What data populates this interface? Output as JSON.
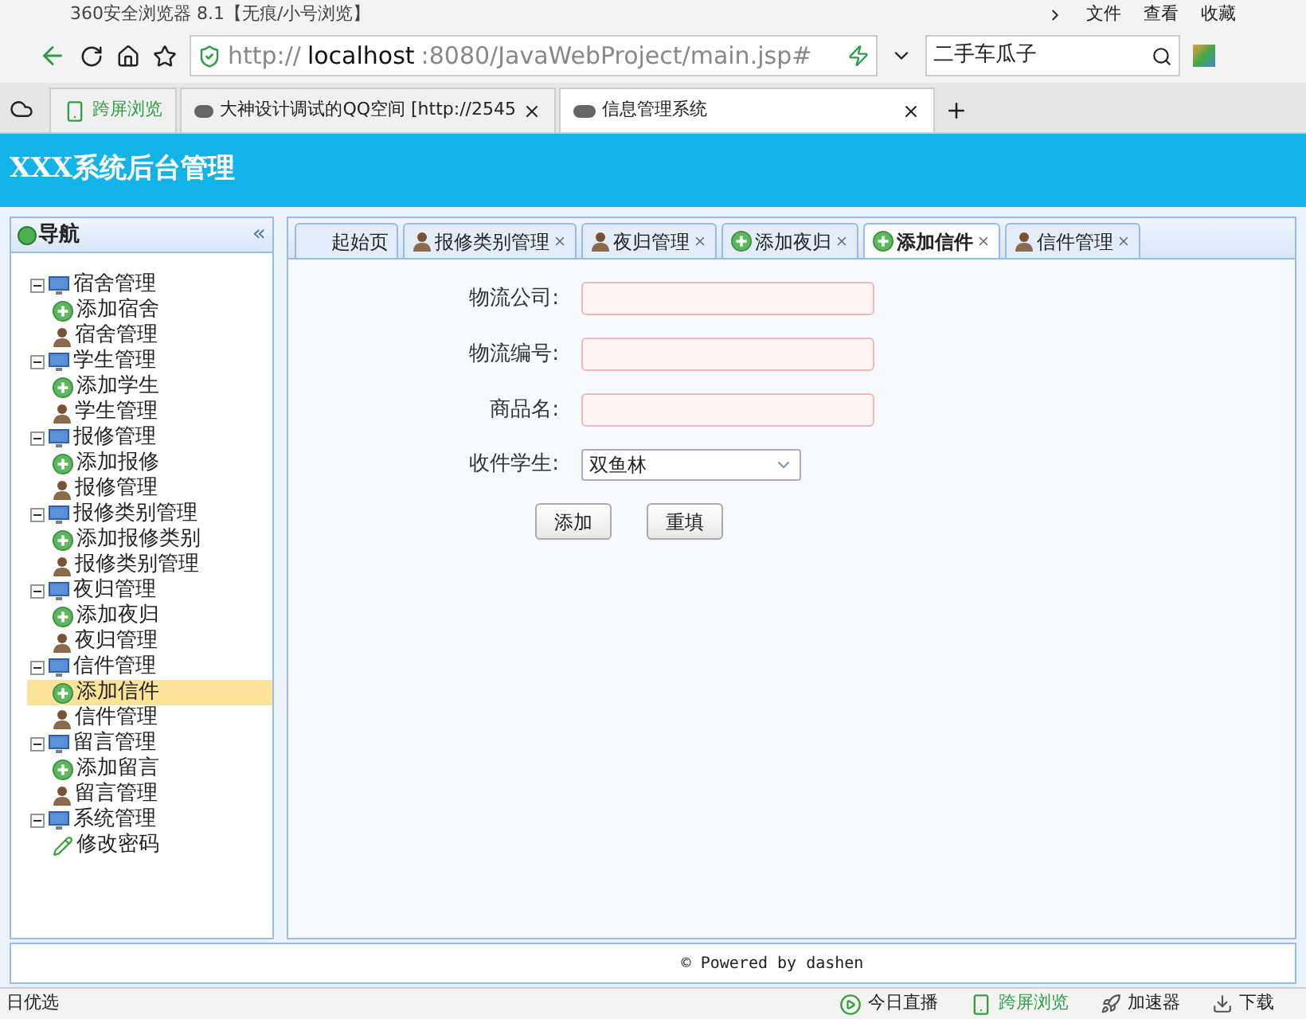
{
  "browser": {
    "title": "360安全浏览器 8.1【无痕/小号浏览】",
    "menu": [
      "文件",
      "查看",
      "收藏"
    ],
    "address": {
      "scheme": "http://",
      "host": "localhost",
      "rest": ":8080/JavaWebProject/main.jsp#"
    },
    "search": {
      "value": "二手车瓜子"
    },
    "tabs": [
      {
        "kind": "pinned",
        "label": "跨屏浏览",
        "selected": false
      },
      {
        "kind": "page",
        "label": "大神设计调试的QQ空间 [http://2545",
        "selected": false
      },
      {
        "kind": "page",
        "label": "信息管理系统",
        "selected": true
      }
    ]
  },
  "header": {
    "title": "XXX系统后台管理"
  },
  "nav": {
    "title": "导航",
    "collapse": "«",
    "groups": [
      {
        "label": "宿舍管理",
        "expanded": true,
        "children": [
          {
            "kind": "add",
            "label": "添加宿舍",
            "selected": false
          },
          {
            "kind": "manage",
            "label": "宿舍管理",
            "selected": false
          }
        ]
      },
      {
        "label": "学生管理",
        "expanded": true,
        "children": [
          {
            "kind": "add",
            "label": "添加学生",
            "selected": false
          },
          {
            "kind": "manage",
            "label": "学生管理",
            "selected": false
          }
        ]
      },
      {
        "label": "报修管理",
        "expanded": true,
        "children": [
          {
            "kind": "add",
            "label": "添加报修",
            "selected": false
          },
          {
            "kind": "manage",
            "label": "报修管理",
            "selected": false
          }
        ]
      },
      {
        "label": "报修类别管理",
        "expanded": true,
        "children": [
          {
            "kind": "add",
            "label": "添加报修类别",
            "selected": false
          },
          {
            "kind": "manage",
            "label": "报修类别管理",
            "selected": false
          }
        ]
      },
      {
        "label": "夜归管理",
        "expanded": true,
        "children": [
          {
            "kind": "add",
            "label": "添加夜归",
            "selected": false
          },
          {
            "kind": "manage",
            "label": "夜归管理",
            "selected": false
          }
        ]
      },
      {
        "label": "信件管理",
        "expanded": true,
        "children": [
          {
            "kind": "add",
            "label": "添加信件",
            "selected": true
          },
          {
            "kind": "manage",
            "label": "信件管理",
            "selected": false
          }
        ]
      },
      {
        "label": "留言管理",
        "expanded": true,
        "children": [
          {
            "kind": "add",
            "label": "添加留言",
            "selected": false
          },
          {
            "kind": "manage",
            "label": "留言管理",
            "selected": false
          }
        ]
      },
      {
        "label": "系统管理",
        "expanded": true,
        "children": [
          {
            "kind": "edit",
            "label": "修改密码",
            "selected": false
          }
        ]
      }
    ]
  },
  "content_tabs": [
    {
      "kind": "home",
      "label": "起始页",
      "closable": false,
      "selected": false
    },
    {
      "kind": "manage",
      "label": "报修类别管理",
      "closable": true,
      "selected": false
    },
    {
      "kind": "manage",
      "label": "夜归管理",
      "closable": true,
      "selected": false
    },
    {
      "kind": "add",
      "label": "添加夜归",
      "closable": true,
      "selected": false
    },
    {
      "kind": "add",
      "label": "添加信件",
      "closable": true,
      "selected": true
    },
    {
      "kind": "manage",
      "label": "信件管理",
      "closable": true,
      "selected": false
    }
  ],
  "form": {
    "fields": [
      {
        "kind": "text",
        "label": "物流公司:"
      },
      {
        "kind": "text",
        "label": "物流编号:"
      },
      {
        "kind": "text",
        "label": "商品名:"
      },
      {
        "kind": "select",
        "label": "收件学生:",
        "value": "双鱼林"
      }
    ],
    "buttons": [
      "添加",
      "重填"
    ]
  },
  "footer": {
    "text": "© Powered by dashen"
  },
  "status_bar": {
    "left": "日优选",
    "items": [
      {
        "kind": "live",
        "label": "今日直播"
      },
      {
        "kind": "screen",
        "label": "跨屏浏览"
      },
      {
        "kind": "speed",
        "label": "加速器"
      },
      {
        "kind": "download",
        "label": "下载"
      }
    ]
  }
}
